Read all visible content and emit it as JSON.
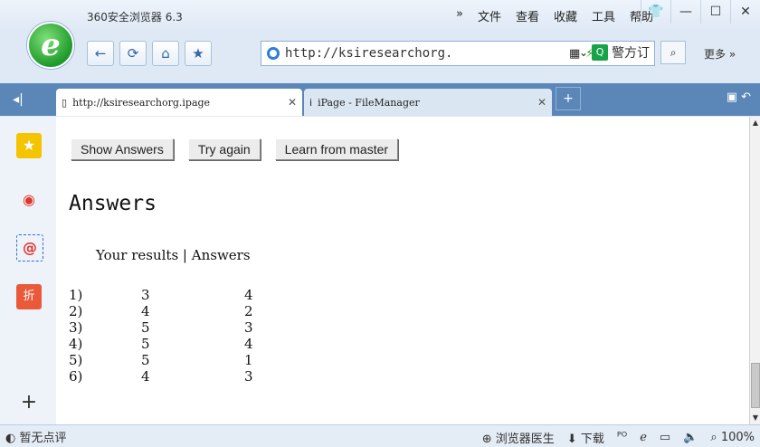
{
  "window": {
    "title": "360安全浏览器 6.3",
    "menu": [
      "»",
      "文件",
      "查看",
      "收藏",
      "工具",
      "帮助"
    ],
    "controls": {
      "skin": "👕",
      "minimize": "—",
      "maximize": "☐",
      "close": "✕"
    }
  },
  "toolbar": {
    "back": "←",
    "refresh": "⟳",
    "home": "⌂",
    "favorite": "★",
    "address": "http://ksiresearchorg.",
    "search_text": "警方订",
    "more": "更多 »"
  },
  "tabs": [
    {
      "label": "http://ksiresearchorg.ipage",
      "close": "✕"
    },
    {
      "label": "iPage - FileManager",
      "close": "✕"
    }
  ],
  "tab_extras": {
    "new": "+"
  },
  "page": {
    "buttons": [
      "Show Answers",
      "Try again",
      "Learn from master"
    ],
    "heading": "Answers",
    "results_header": "Your results | Answers",
    "rows": [
      {
        "n": "1)",
        "yours": "3",
        "answer": "4"
      },
      {
        "n": "2)",
        "yours": "4",
        "answer": "2"
      },
      {
        "n": "3)",
        "yours": "5",
        "answer": "3"
      },
      {
        "n": "4)",
        "yours": "5",
        "answer": "4"
      },
      {
        "n": "5)",
        "yours": "5",
        "answer": "1"
      },
      {
        "n": "6)",
        "yours": "4",
        "answer": "3"
      }
    ]
  },
  "status": {
    "left": "暂无点评",
    "doctor": "浏览器医生",
    "download": "下载",
    "zoom": "100%"
  }
}
